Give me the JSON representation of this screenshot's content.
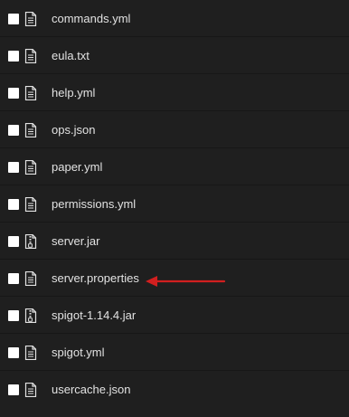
{
  "files": [
    {
      "name": "commands.yml",
      "icon": "text-file-icon"
    },
    {
      "name": "eula.txt",
      "icon": "text-file-icon"
    },
    {
      "name": "help.yml",
      "icon": "text-file-icon"
    },
    {
      "name": "ops.json",
      "icon": "text-file-icon"
    },
    {
      "name": "paper.yml",
      "icon": "text-file-icon"
    },
    {
      "name": "permissions.yml",
      "icon": "text-file-icon"
    },
    {
      "name": "server.jar",
      "icon": "archive-file-icon"
    },
    {
      "name": "server.properties",
      "icon": "text-file-icon"
    },
    {
      "name": "spigot-1.14.4.jar",
      "icon": "archive-file-icon"
    },
    {
      "name": "spigot.yml",
      "icon": "text-file-icon"
    },
    {
      "name": "usercache.json",
      "icon": "text-file-icon"
    }
  ],
  "annotation": {
    "target_file": "server.properties",
    "color": "#d11f1f"
  },
  "colors": {
    "background": "#1f1f1f",
    "text": "#e2e2e2",
    "checkbox": "#ffffff"
  }
}
